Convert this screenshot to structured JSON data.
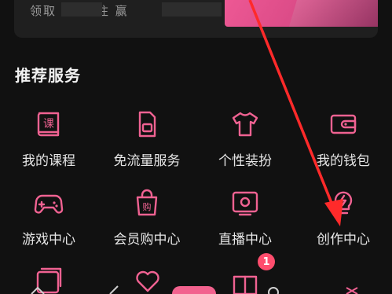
{
  "promo": {
    "text": "领取 ... 持住 赢"
  },
  "section": {
    "title": "推荐服务"
  },
  "services": [
    {
      "label": "我的课程",
      "icon": "course-book-icon"
    },
    {
      "label": "免流量服务",
      "icon": "sim-card-icon"
    },
    {
      "label": "个性装扮",
      "icon": "tshirt-icon"
    },
    {
      "label": "我的钱包",
      "icon": "wallet-icon"
    },
    {
      "label": "游戏中心",
      "icon": "gamepad-icon"
    },
    {
      "label": "会员购中心",
      "icon": "shopping-bag-icon"
    },
    {
      "label": "直播中心",
      "icon": "tv-live-icon"
    },
    {
      "label": "创作中心",
      "icon": "lightbulb-icon"
    }
  ],
  "badges": {
    "gift_count": "1"
  },
  "colors": {
    "accent": "#f06292",
    "background": "#111111",
    "annotation_arrow": "#ff2a2a"
  }
}
